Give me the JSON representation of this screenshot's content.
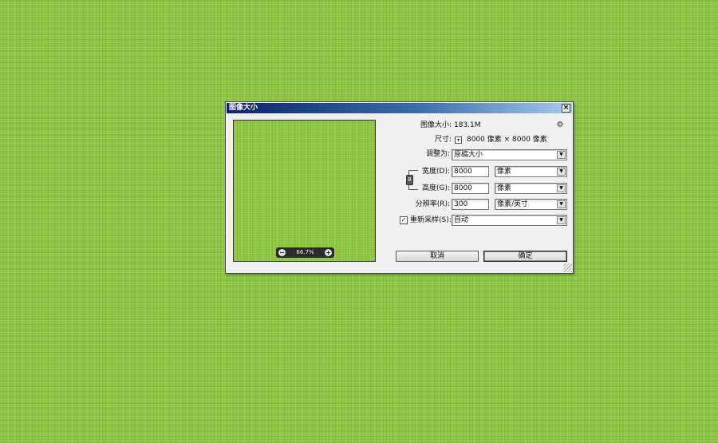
{
  "dialog": {
    "title": "图像大小",
    "close_label": "×",
    "zoom": {
      "out_label": "−",
      "level": "66.7%",
      "in_label": "+"
    },
    "image_size": {
      "label": "图像大小:",
      "value": "183.1M"
    },
    "dimensions": {
      "label": "尺寸:",
      "dropdown_glyph": "▾",
      "value": "8000 像素  ×  8000 像素"
    },
    "fit_to": {
      "label": "调整为:",
      "value": "原稿大小"
    },
    "width": {
      "label": "宽度(D):",
      "value": "8000",
      "unit": "像素"
    },
    "height": {
      "label": "高度(G):",
      "value": "8000",
      "unit": "像素"
    },
    "resolution": {
      "label": "分辨率(R):",
      "value": "300",
      "unit": "像素/英寸"
    },
    "resample": {
      "checked": true,
      "check_glyph": "✓",
      "label": "重新采样(S):",
      "value": "自动"
    },
    "cancel_label": "取消",
    "ok_label": "确定",
    "dropdown_arrow": "▼",
    "gear_glyph": "⚙",
    "link_glyph": "8"
  },
  "colors": {
    "background": "#8cc63f",
    "titlebar_start": "#0a246a",
    "titlebar_end": "#a6caf0"
  },
  "icons": [
    "close-icon",
    "zoom-out-icon",
    "zoom-in-icon",
    "gear-icon",
    "link-icon",
    "checkmark-icon",
    "chevron-down-icon",
    "resize-grip-icon"
  ]
}
